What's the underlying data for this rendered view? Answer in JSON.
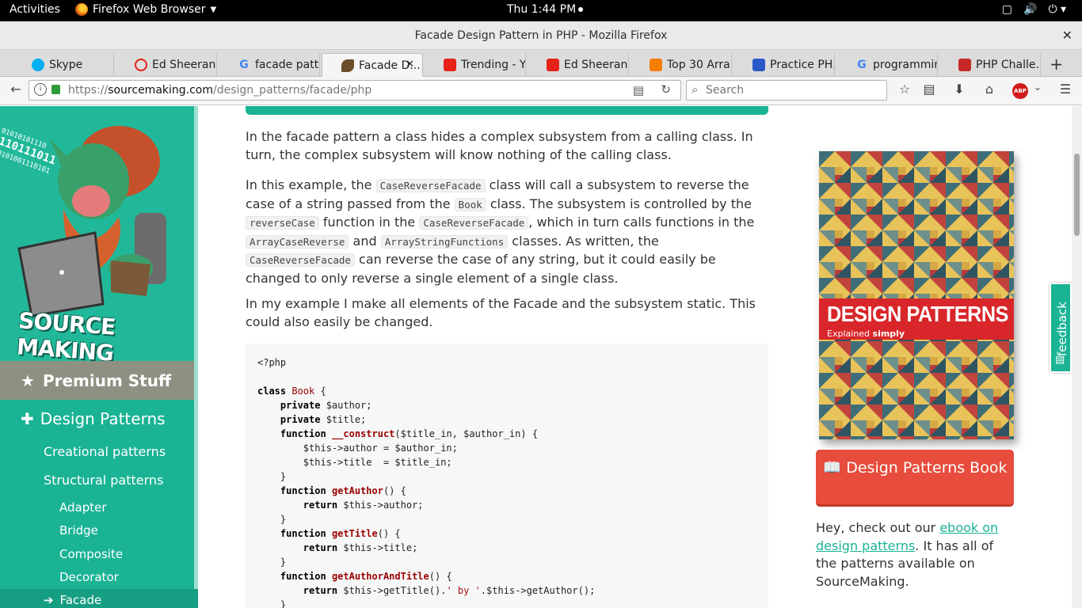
{
  "system": {
    "activities": "Activities",
    "app_name": "Firefox Web Browser",
    "clock": "Thu  1:44 PM"
  },
  "window": {
    "title": "Facade Design Pattern in PHP - Mozilla Firefox"
  },
  "tabs": [
    {
      "label": "Skype",
      "fav_color": "#00aff0"
    },
    {
      "label": "Ed Sheeran ...",
      "fav_color": "#e62117"
    },
    {
      "label": "facade patte...",
      "fav_color": "#4285f4"
    },
    {
      "label": "Facade D...",
      "fav_color": "#6b4e2a",
      "active": true
    },
    {
      "label": "Trending - Y...",
      "fav_color": "#e62117"
    },
    {
      "label": "Ed Sheeran ...",
      "fav_color": "#e62117"
    },
    {
      "label": "Top 30 Arra...",
      "fav_color": "#f57d00"
    },
    {
      "label": "Practice PH...",
      "fav_color": "#2b58c8"
    },
    {
      "label": "programmin...",
      "fav_color": "#4285f4"
    },
    {
      "label": "PHP Challe...",
      "fav_color": "#c62828"
    }
  ],
  "navbar": {
    "url_prefix": "https://",
    "url_domain": "sourcemaking.com",
    "url_path": "/design_patterns/facade/php",
    "search_placeholder": "Search",
    "abp": "ABP"
  },
  "sidebar": {
    "logo_text": "SOURCE MAKING",
    "premium": "Premium Stuff",
    "section": "Design Patterns",
    "groups": [
      "Creational patterns",
      "Structural patterns"
    ],
    "items": [
      "Adapter",
      "Bridge",
      "Composite",
      "Decorator",
      "Facade"
    ]
  },
  "content": {
    "p1": "In the facade pattern a class hides a complex subsystem from a calling class. In turn, the complex subsystem will know nothing of the calling class.",
    "p2": {
      "a": "In this example, the ",
      "c1": "CaseReverseFacade",
      "b": " class will call a subsystem to reverse the case of a string passed from the ",
      "c2": "Book",
      "c": " class. The subsystem is controlled by the ",
      "c3": "reverseCase",
      "d": " function in the ",
      "c4": "CaseReverseFacade",
      "e": ", which in turn calls functions in the ",
      "c5": "ArrayCaseReverse",
      "f": " and ",
      "c6": "ArrayStringFunctions",
      "g": " classes. As written, the ",
      "c7": "CaseReverseFacade",
      "h": " can reverse the case of any string, but it could easily be changed to only reverse a single element of a single class."
    },
    "p3": "In my example I make all elements of the Facade and the subsystem static. This could also easily be changed.",
    "code": [
      "<?php",
      "",
      "class Book {",
      "    private $author;",
      "    private $title;",
      "    function __construct($title_in, $author_in) {",
      "        $this->author = $author_in;",
      "        $this->title  = $title_in;",
      "    }",
      "    function getAuthor() {",
      "        return $this->author;",
      "    }",
      "    function getTitle() {",
      "        return $this->title;",
      "    }",
      "    function getAuthorAndTitle() {",
      "        return $this->getTitle().' by '.$this->getAuthor();",
      "    }"
    ]
  },
  "right": {
    "book_title": "DESIGN PATTERNS",
    "book_sub_a": "Explained ",
    "book_sub_b": "simply",
    "button": "Design Patterns Book",
    "promo_a": "Hey, check out our ",
    "promo_link": "ebook on design patterns",
    "promo_b": ". It has all of the patterns available on SourceMaking."
  },
  "feedback": "feedback"
}
